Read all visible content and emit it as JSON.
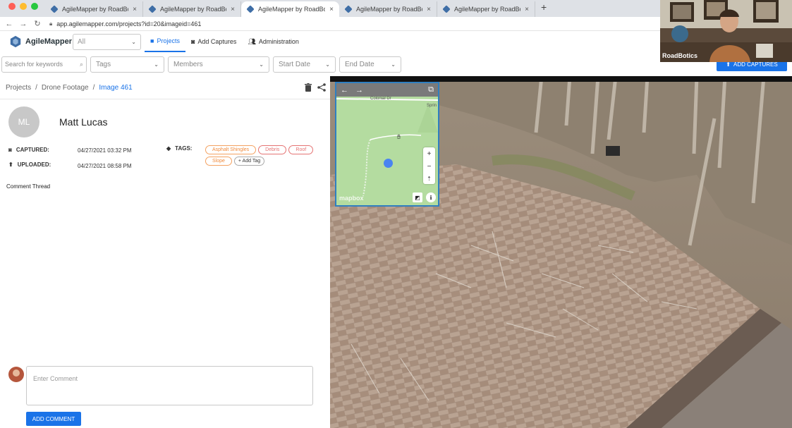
{
  "browser": {
    "tabs": [
      {
        "title": "AgileMapper by RoadBotics",
        "active": false
      },
      {
        "title": "AgileMapper by RoadBotics",
        "active": false
      },
      {
        "title": "AgileMapper by RoadBotics",
        "active": true
      },
      {
        "title": "AgileMapper by RoadBotics",
        "active": false
      },
      {
        "title": "AgileMapper by RoadBotics",
        "active": false
      }
    ],
    "close_glyph": "×",
    "new_tab_glyph": "+",
    "url": "app.agilemapper.com/projects?id=20&imageid=461"
  },
  "app": {
    "name": "AgileMapper",
    "project_select": "All",
    "nav": {
      "projects": "Projects",
      "add_captures": "Add Captures",
      "administration": "Administration"
    }
  },
  "filters": {
    "search_placeholder": "Search for keywords",
    "tags": "Tags",
    "members": "Members",
    "start_date": "Start Date",
    "end_date": "End Date"
  },
  "add_captures_button": "ADD CAPTURES",
  "breadcrumb": {
    "projects": "Projects",
    "folder": "Drone Footage",
    "current": "Image 461",
    "separator": "/"
  },
  "detail": {
    "avatar_initials": "ML",
    "user_name": "Matt Lucas",
    "captured_label": "CAPTURED:",
    "captured_value": "04/27/2021 03:32 PM",
    "uploaded_label": "UPLOADED:",
    "uploaded_value": "04/27/2021 08:58 PM",
    "tags_label": "TAGS:",
    "tags": [
      "Asphalt Shingles",
      "Debris",
      "Roof",
      "Slope"
    ],
    "add_tag": "+ Add Tag",
    "comment_thread": "Comment Thread",
    "comment_placeholder": "Enter Comment",
    "add_comment_button": "ADD COMMENT"
  },
  "minimap": {
    "road_label_1": "Colonial Dr",
    "road_label_2": "Sprin",
    "zoom_in": "+",
    "zoom_out": "−",
    "attribution": "mapbox"
  },
  "webcam": {
    "label": "RoadBotics"
  },
  "colors": {
    "accent": "#1a73e8",
    "tag_orange": "#f08a3c",
    "tag_red": "#e57373",
    "minimap_border": "#2f7fc0"
  }
}
